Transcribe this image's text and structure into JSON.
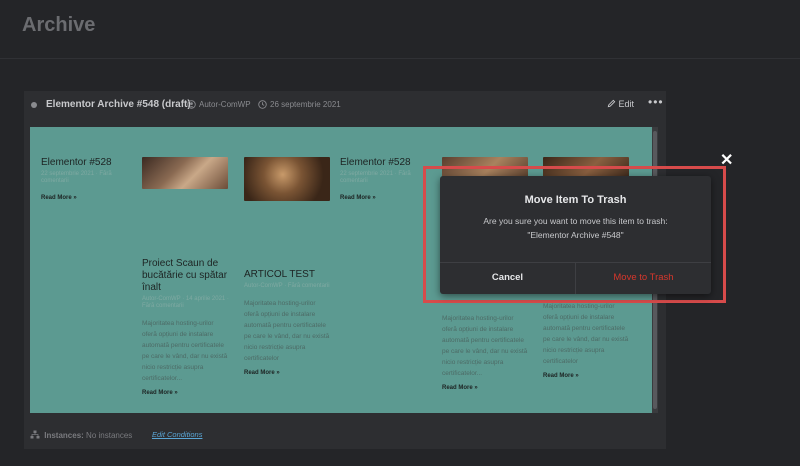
{
  "page": {
    "title": "Archive"
  },
  "card": {
    "title": "Elementor Archive #548 (draft)",
    "author": "Autor-ComWP",
    "date": "26 septembrie 2021",
    "edit_label": "Edit",
    "more_label": "•••"
  },
  "preview": {
    "posts": [
      {
        "title": "Elementor #528",
        "meta": "22 septembrie 2021 · Fără comentarii",
        "read_more": "Read More »"
      },
      {
        "title": "Proiect Scaun de bucătărie cu spătar înalt",
        "meta": "Autor-ComWP · 14 aprilie 2021 · Fără comentarii",
        "excerpt": "Majoritatea hosting-urilor oferă opțiuni de instalare automată pentru certificatele pe care le vând, dar nu există nicio restricție asupra certificatelor...",
        "read_more": "Read More »"
      },
      {
        "title": "ARTICOL TEST",
        "meta": "Autor-ComWP · Fără comentarii",
        "excerpt": "Majoritatea hosting-urilor oferă opțiuni de instalare automată pentru certificatele pe care le vând, dar nu există nicio restricție asupra certificatelor",
        "read_more": "Read More »"
      },
      {
        "title": "Elementor #528",
        "meta": "22 septembrie 2021 · Fără comentarii",
        "read_more": "Read More »"
      },
      {
        "excerpt": "Majoritatea hosting-urilor oferă opțiuni de instalare automată pentru certificatele pe care le vând, dar nu există nicio restricție asupra certificatelor...",
        "read_more": "Read More »"
      },
      {
        "excerpt": "Majoritatea hosting-urilor oferă opțiuni de instalare automată pentru certificatele pe care le vând, dar nu există nicio restricție asupra certificatelor",
        "read_more": "Read More »"
      }
    ]
  },
  "footer": {
    "instances_label": "Instances:",
    "instances_value": "No instances",
    "edit_conditions": "Edit Conditions"
  },
  "modal": {
    "title": "Move Item To Trash",
    "message_line1": "Are you sure you want to move this item to trash:",
    "message_line2": "\"Elementor Archive #548\"",
    "cancel_label": "Cancel",
    "confirm_label": "Move to Trash",
    "close_label": "✕"
  },
  "colors": {
    "background": "#242528",
    "preview": "#5c9a91",
    "danger": "#d6372c",
    "highlight": "#d74b4b",
    "link": "#5aa6d6"
  }
}
